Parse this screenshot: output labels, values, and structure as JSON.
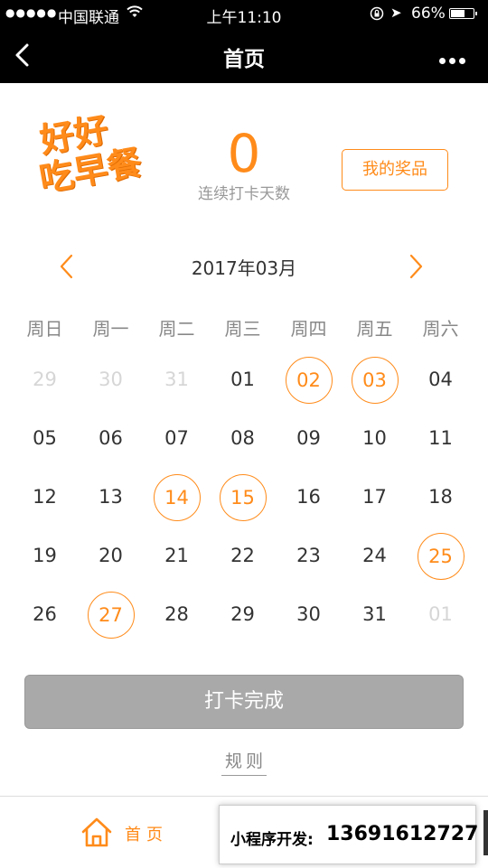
{
  "status_bar": {
    "signal": "●●●●●",
    "carrier": "中国联通",
    "time": "上午11:10",
    "battery_pct": "66%",
    "battery_level": 0.66
  },
  "nav": {
    "title": "首页"
  },
  "header": {
    "logo_line1": "好好",
    "logo_line2": "吃早餐",
    "streak_count": "0",
    "streak_label": "连续打卡天数",
    "prize_button": "我的奖品"
  },
  "calendar": {
    "month_label": "2017年03月",
    "weekdays": [
      "周日",
      "周一",
      "周二",
      "周三",
      "周四",
      "周五",
      "周六"
    ],
    "weeks": [
      [
        {
          "d": "29",
          "other": true
        },
        {
          "d": "30",
          "other": true
        },
        {
          "d": "31",
          "other": true
        },
        {
          "d": "01"
        },
        {
          "d": "02",
          "checked": true
        },
        {
          "d": "03",
          "checked": true
        },
        {
          "d": "04"
        }
      ],
      [
        {
          "d": "05"
        },
        {
          "d": "06"
        },
        {
          "d": "07"
        },
        {
          "d": "08"
        },
        {
          "d": "09"
        },
        {
          "d": "10"
        },
        {
          "d": "11"
        }
      ],
      [
        {
          "d": "12"
        },
        {
          "d": "13"
        },
        {
          "d": "14",
          "checked": true
        },
        {
          "d": "15",
          "checked": true
        },
        {
          "d": "16"
        },
        {
          "d": "17"
        },
        {
          "d": "18"
        }
      ],
      [
        {
          "d": "19"
        },
        {
          "d": "20"
        },
        {
          "d": "21"
        },
        {
          "d": "22"
        },
        {
          "d": "23"
        },
        {
          "d": "24"
        },
        {
          "d": "25",
          "checked": true
        }
      ],
      [
        {
          "d": "26"
        },
        {
          "d": "27",
          "checked": true
        },
        {
          "d": "28"
        },
        {
          "d": "29"
        },
        {
          "d": "30"
        },
        {
          "d": "31"
        },
        {
          "d": "01",
          "other": true
        }
      ]
    ]
  },
  "checkin_button": "打卡完成",
  "rules_link": "规则",
  "tabbar": {
    "home_label": "首页"
  },
  "ad_banner": {
    "label": "小程序开发:",
    "phone": "13691612727"
  },
  "colors": {
    "accent": "#ff8b1a",
    "button_disabled": "#a9a9a9"
  }
}
